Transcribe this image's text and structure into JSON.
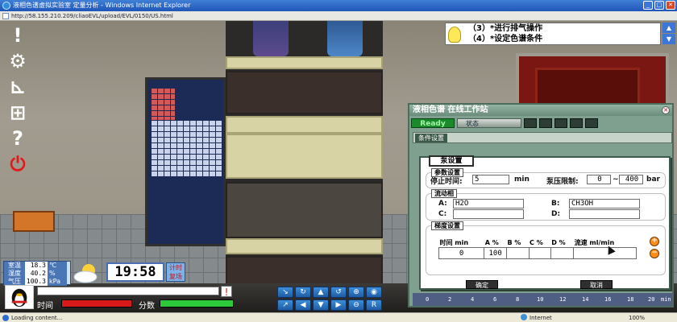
{
  "window": {
    "title": "液相色谱虚拟实验室 定量分析 - Windows Internet Explorer",
    "address": "http://58.155.210.209/cliaoEVL/upload/EVL/0150/US.html",
    "status_text": "Loading content...",
    "zone": "Internet",
    "zoom": "100%"
  },
  "left_toolbar": {
    "items": [
      {
        "name": "alert",
        "glyph": "!"
      },
      {
        "name": "settings",
        "glyph": "⚙"
      },
      {
        "name": "chart",
        "glyph": "⊾"
      },
      {
        "name": "grid",
        "glyph": "⊞"
      },
      {
        "name": "help",
        "glyph": "?"
      },
      {
        "name": "power",
        "glyph": "⏻"
      }
    ]
  },
  "environment": {
    "temp_label": "室温",
    "temp_value": "18.3",
    "temp_unit": "℃",
    "humidity_label": "湿度",
    "humidity_value": "40.2",
    "humidity_unit": "%",
    "pressure_label": "气压",
    "pressure_value": "100.3",
    "pressure_unit": "kPa"
  },
  "clock": {
    "time": "19:58",
    "timer_label": "计时",
    "timer_sub": "复场"
  },
  "bottom": {
    "time_label": "时间",
    "score_label": "分数",
    "time_progress": 1.0,
    "score_progress": 1.0,
    "message": ""
  },
  "nav_buttons": [
    "↘",
    "↻",
    "▲",
    "↺",
    "⊕",
    "◉",
    "↗",
    "◀",
    "▼",
    "▶",
    "⊖",
    "R"
  ],
  "task_tip": {
    "line1": "（3）*进行排气操作",
    "line2": "（4）*设定色谱条件"
  },
  "hplc_window": {
    "title": "液相色谱 在线工作站",
    "ready": "Ready",
    "status_tab": "状态",
    "condition_tab": "条件设置",
    "axis_ticks": [
      "0",
      "2",
      "4",
      "6",
      "8",
      "10",
      "12",
      "14",
      "16",
      "18",
      "20"
    ],
    "axis_unit": "min"
  },
  "pump_dialog": {
    "title": "泵设置",
    "params_title": "参数设置",
    "stop_time_label": "停止时间:",
    "stop_time_value": "5",
    "stop_time_unit": "min",
    "pressure_limit_label": "泵压限制:",
    "pressure_min": "0",
    "pressure_sep": "~",
    "pressure_max": "400",
    "pressure_unit": "bar",
    "mobile_title": "流动相",
    "a_label": "A:",
    "a_value": "H2O",
    "b_label": "B:",
    "b_value": "CH3OH",
    "c_label": "C:",
    "c_value": "",
    "d_label": "D:",
    "d_value": "",
    "gradient_title": "梯度设置",
    "gradient_headers": [
      "时间 min",
      "A %",
      "B %",
      "C %",
      "D %",
      "流速 ml/min"
    ],
    "gradient_rows": [
      [
        "0",
        "100",
        "",
        "",
        "",
        ""
      ]
    ],
    "ok_label": "确定",
    "cancel_label": "取消",
    "add_button": "+",
    "remove_button": "−"
  }
}
